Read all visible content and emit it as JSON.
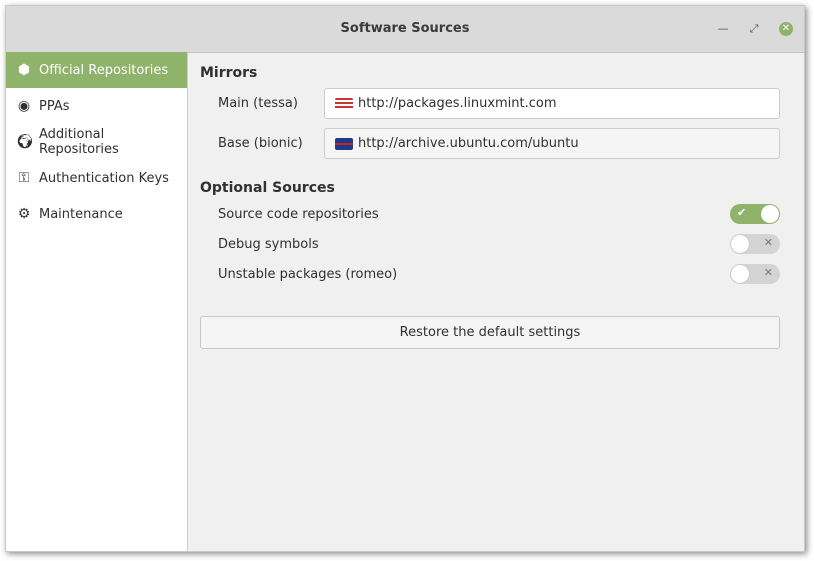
{
  "window": {
    "title": "Software Sources"
  },
  "sidebar": {
    "items": [
      {
        "label": "Official Repositories",
        "icon": "package-icon"
      },
      {
        "label": "PPAs",
        "icon": "ppa-icon"
      },
      {
        "label": "Additional Repositories",
        "icon": "globe-icon"
      },
      {
        "label": "Authentication Keys",
        "icon": "key-icon"
      },
      {
        "label": "Maintenance",
        "icon": "maintenance-icon"
      }
    ]
  },
  "mirrors": {
    "heading": "Mirrors",
    "main_label": "Main (tessa)",
    "main_url": "http://packages.linuxmint.com",
    "base_label": "Base (bionic)",
    "base_url": "http://archive.ubuntu.com/ubuntu"
  },
  "optional": {
    "heading": "Optional Sources",
    "items": [
      {
        "label": "Source code repositories",
        "on": true
      },
      {
        "label": "Debug symbols",
        "on": false
      },
      {
        "label": "Unstable packages (romeo)",
        "on": false
      }
    ]
  },
  "restore_label": "Restore the default settings",
  "colors": {
    "accent": "#8fb36a"
  }
}
